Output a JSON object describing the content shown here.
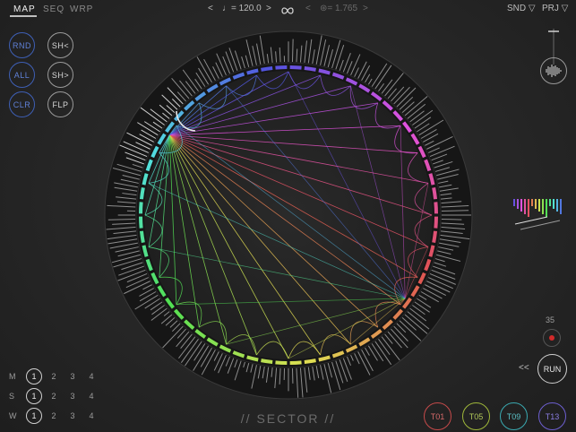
{
  "tabs": [
    {
      "label": "MAP",
      "active": true
    },
    {
      "label": "SEQ",
      "active": false
    },
    {
      "label": "WRP",
      "active": false
    }
  ],
  "header": {
    "tempo_prev": "<",
    "tempo": "♩= 120.0",
    "tempo_next": ">",
    "link_icon": "infinity-icon",
    "ratio_prev": "<",
    "ratio": "⊛= 1.765",
    "ratio_next": ">",
    "snd_label": "SND ▽",
    "prj_label": "PRJ ▽"
  },
  "left_buttons": {
    "rnd": "RND",
    "all": "ALL",
    "clr": "CLR",
    "shift_left": "SH<",
    "shift_right": "SH>",
    "flip": "FLP"
  },
  "rows": [
    {
      "label": "M",
      "values": [
        "1",
        "2",
        "3",
        "4"
      ],
      "selected": 0
    },
    {
      "label": "S",
      "values": [
        "1",
        "2",
        "3",
        "4"
      ],
      "selected": 0
    },
    {
      "label": "W",
      "values": [
        "1",
        "2",
        "3",
        "4"
      ],
      "selected": 0
    }
  ],
  "sector_title": "// SECTOR //",
  "right_controls": {
    "count": "35",
    "rewind": "<<",
    "run": "RUN"
  },
  "tracks": [
    {
      "label": "T01",
      "color": "#c54a4a"
    },
    {
      "label": "T05",
      "color": "#9fb83a"
    },
    {
      "label": "T09",
      "color": "#3aa9b0"
    },
    {
      "label": "T13",
      "color": "#6d5fd0"
    }
  ],
  "colors": {
    "accent_blue": "#3e5fb5",
    "record_red": "#d12a2a"
  }
}
